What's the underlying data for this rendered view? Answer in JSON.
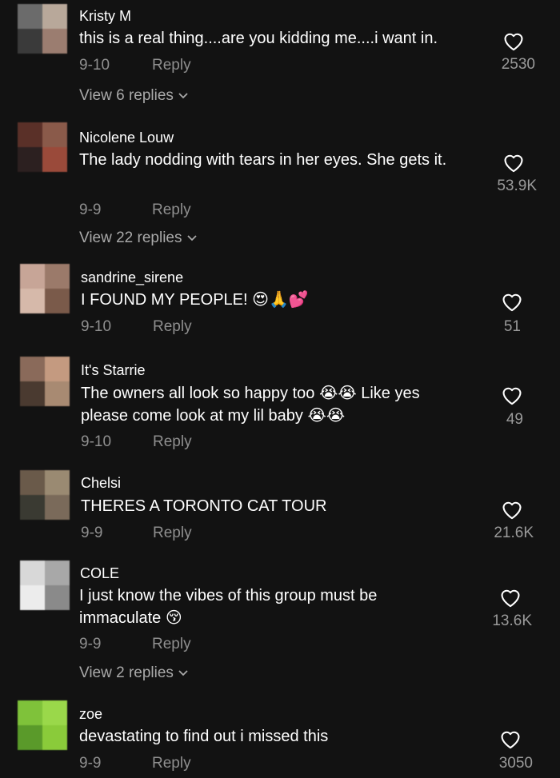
{
  "comments": [
    {
      "username": "Kristy M",
      "text": "this is a real thing....are you kidding me....i want in.",
      "date": "9-10",
      "reply_label": "Reply",
      "likes": "2530",
      "view_replies": "View 6 replies",
      "avatar_colors": [
        "#6b6b6b",
        "#b8a89a",
        "#3a3a3a",
        "#9b7d70"
      ]
    },
    {
      "username": "Nicolene Louw",
      "text": "The lady nodding with tears in her eyes. She gets it.",
      "date": "9-9",
      "reply_label": "Reply",
      "likes": "53.9K",
      "view_replies": "View 22 replies",
      "avatar_colors": [
        "#5a3028",
        "#8a5a4a",
        "#2c2020",
        "#9a4a3a"
      ]
    },
    {
      "username": "sandrine_sirene",
      "text": "I FOUND MY PEOPLE! 😍🙏💕",
      "date": "9-10",
      "reply_label": "Reply",
      "likes": "51",
      "view_replies": "",
      "avatar_colors": [
        "#c7a597",
        "#9b7a6a",
        "#d6b9aa",
        "#7a5a4a"
      ]
    },
    {
      "username": "It's Starrie",
      "text": "The owners all look so happy too 😭😭 Like yes please come look at my lil baby 😭😭",
      "date": "9-10",
      "reply_label": "Reply",
      "likes": "49",
      "view_replies": "",
      "avatar_colors": [
        "#8a6a5a",
        "#c49a80",
        "#4a3a30",
        "#a88a72"
      ]
    },
    {
      "username": "Chelsi",
      "text": "THERES A TORONTO CAT TOUR",
      "date": "9-9",
      "reply_label": "Reply",
      "likes": "21.6K",
      "view_replies": "",
      "avatar_colors": [
        "#6a5a4a",
        "#9a8a72",
        "#3a3a32",
        "#7a6a5a"
      ]
    },
    {
      "username": "COLE",
      "text": "I just know the vibes of this group must be immaculate 😚",
      "date": "9-9",
      "reply_label": "Reply",
      "likes": "13.6K",
      "view_replies": "View 2 replies",
      "avatar_colors": [
        "#d8d8d8",
        "#a8a8a8",
        "#ececec",
        "#8a8a8a"
      ]
    },
    {
      "username": "zoe",
      "text": "devastating to find out i missed this",
      "date": "9-9",
      "reply_label": "Reply",
      "likes": "3050",
      "view_replies": "",
      "avatar_colors": [
        "#7fc23a",
        "#9ad84a",
        "#5a9a2a",
        "#8acb3a"
      ]
    }
  ],
  "colors": {
    "background": "#121212",
    "text": "#ffffff",
    "muted": "#8f8f8f"
  }
}
